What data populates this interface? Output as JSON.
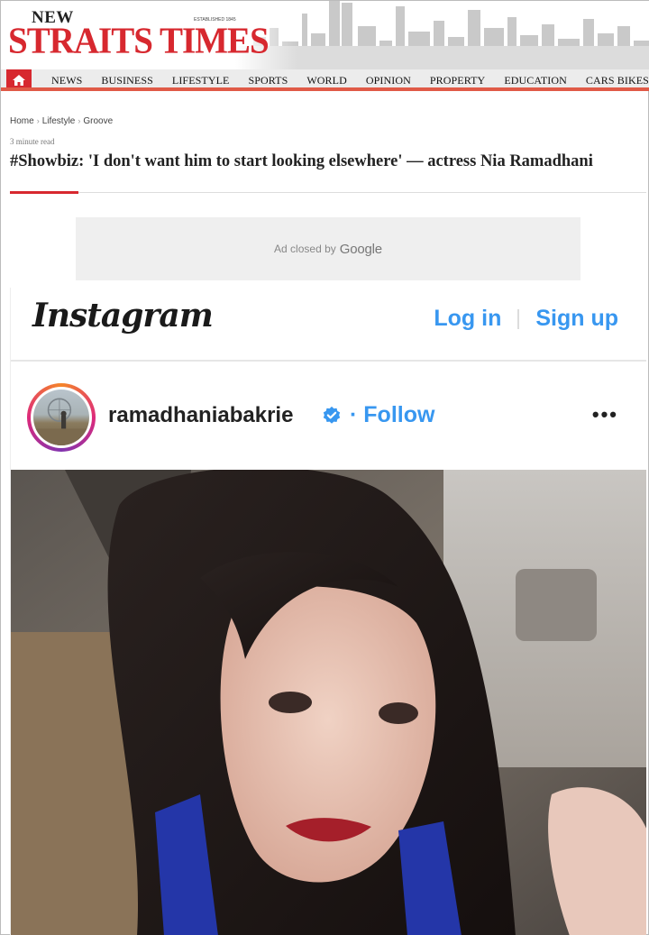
{
  "masthead": {
    "logo_top": "NEW",
    "logo_main": "STRAITS TIMES",
    "logo_est": "ESTABLISHED 1845"
  },
  "nav": {
    "home_icon": "home-icon",
    "items": [
      "NEWS",
      "BUSINESS",
      "LIFESTYLE",
      "SPORTS",
      "WORLD",
      "OPINION",
      "PROPERTY",
      "EDUCATION",
      "CARS BIKES TRUCKS"
    ]
  },
  "breadcrumb": [
    "Home",
    "Lifestyle",
    "Groove"
  ],
  "article": {
    "read_time": "3 minute read",
    "headline": "#Showbiz: 'I don't want him to start looking elsewhere' — actress Nia Ramadhani"
  },
  "ad": {
    "text": "Ad closed by",
    "brand": "Google"
  },
  "instagram": {
    "logo": "Instagram",
    "login": "Log in",
    "signup": "Sign up",
    "username": "ramadhaniabakrie",
    "verified_icon": "verified-badge-icon",
    "follow": "· Follow",
    "more_icon": "more-options-icon",
    "more": "•••"
  },
  "colors": {
    "brand_red": "#d7282f",
    "instagram_blue": "#3897f0",
    "nav_bg": "#ececec"
  }
}
